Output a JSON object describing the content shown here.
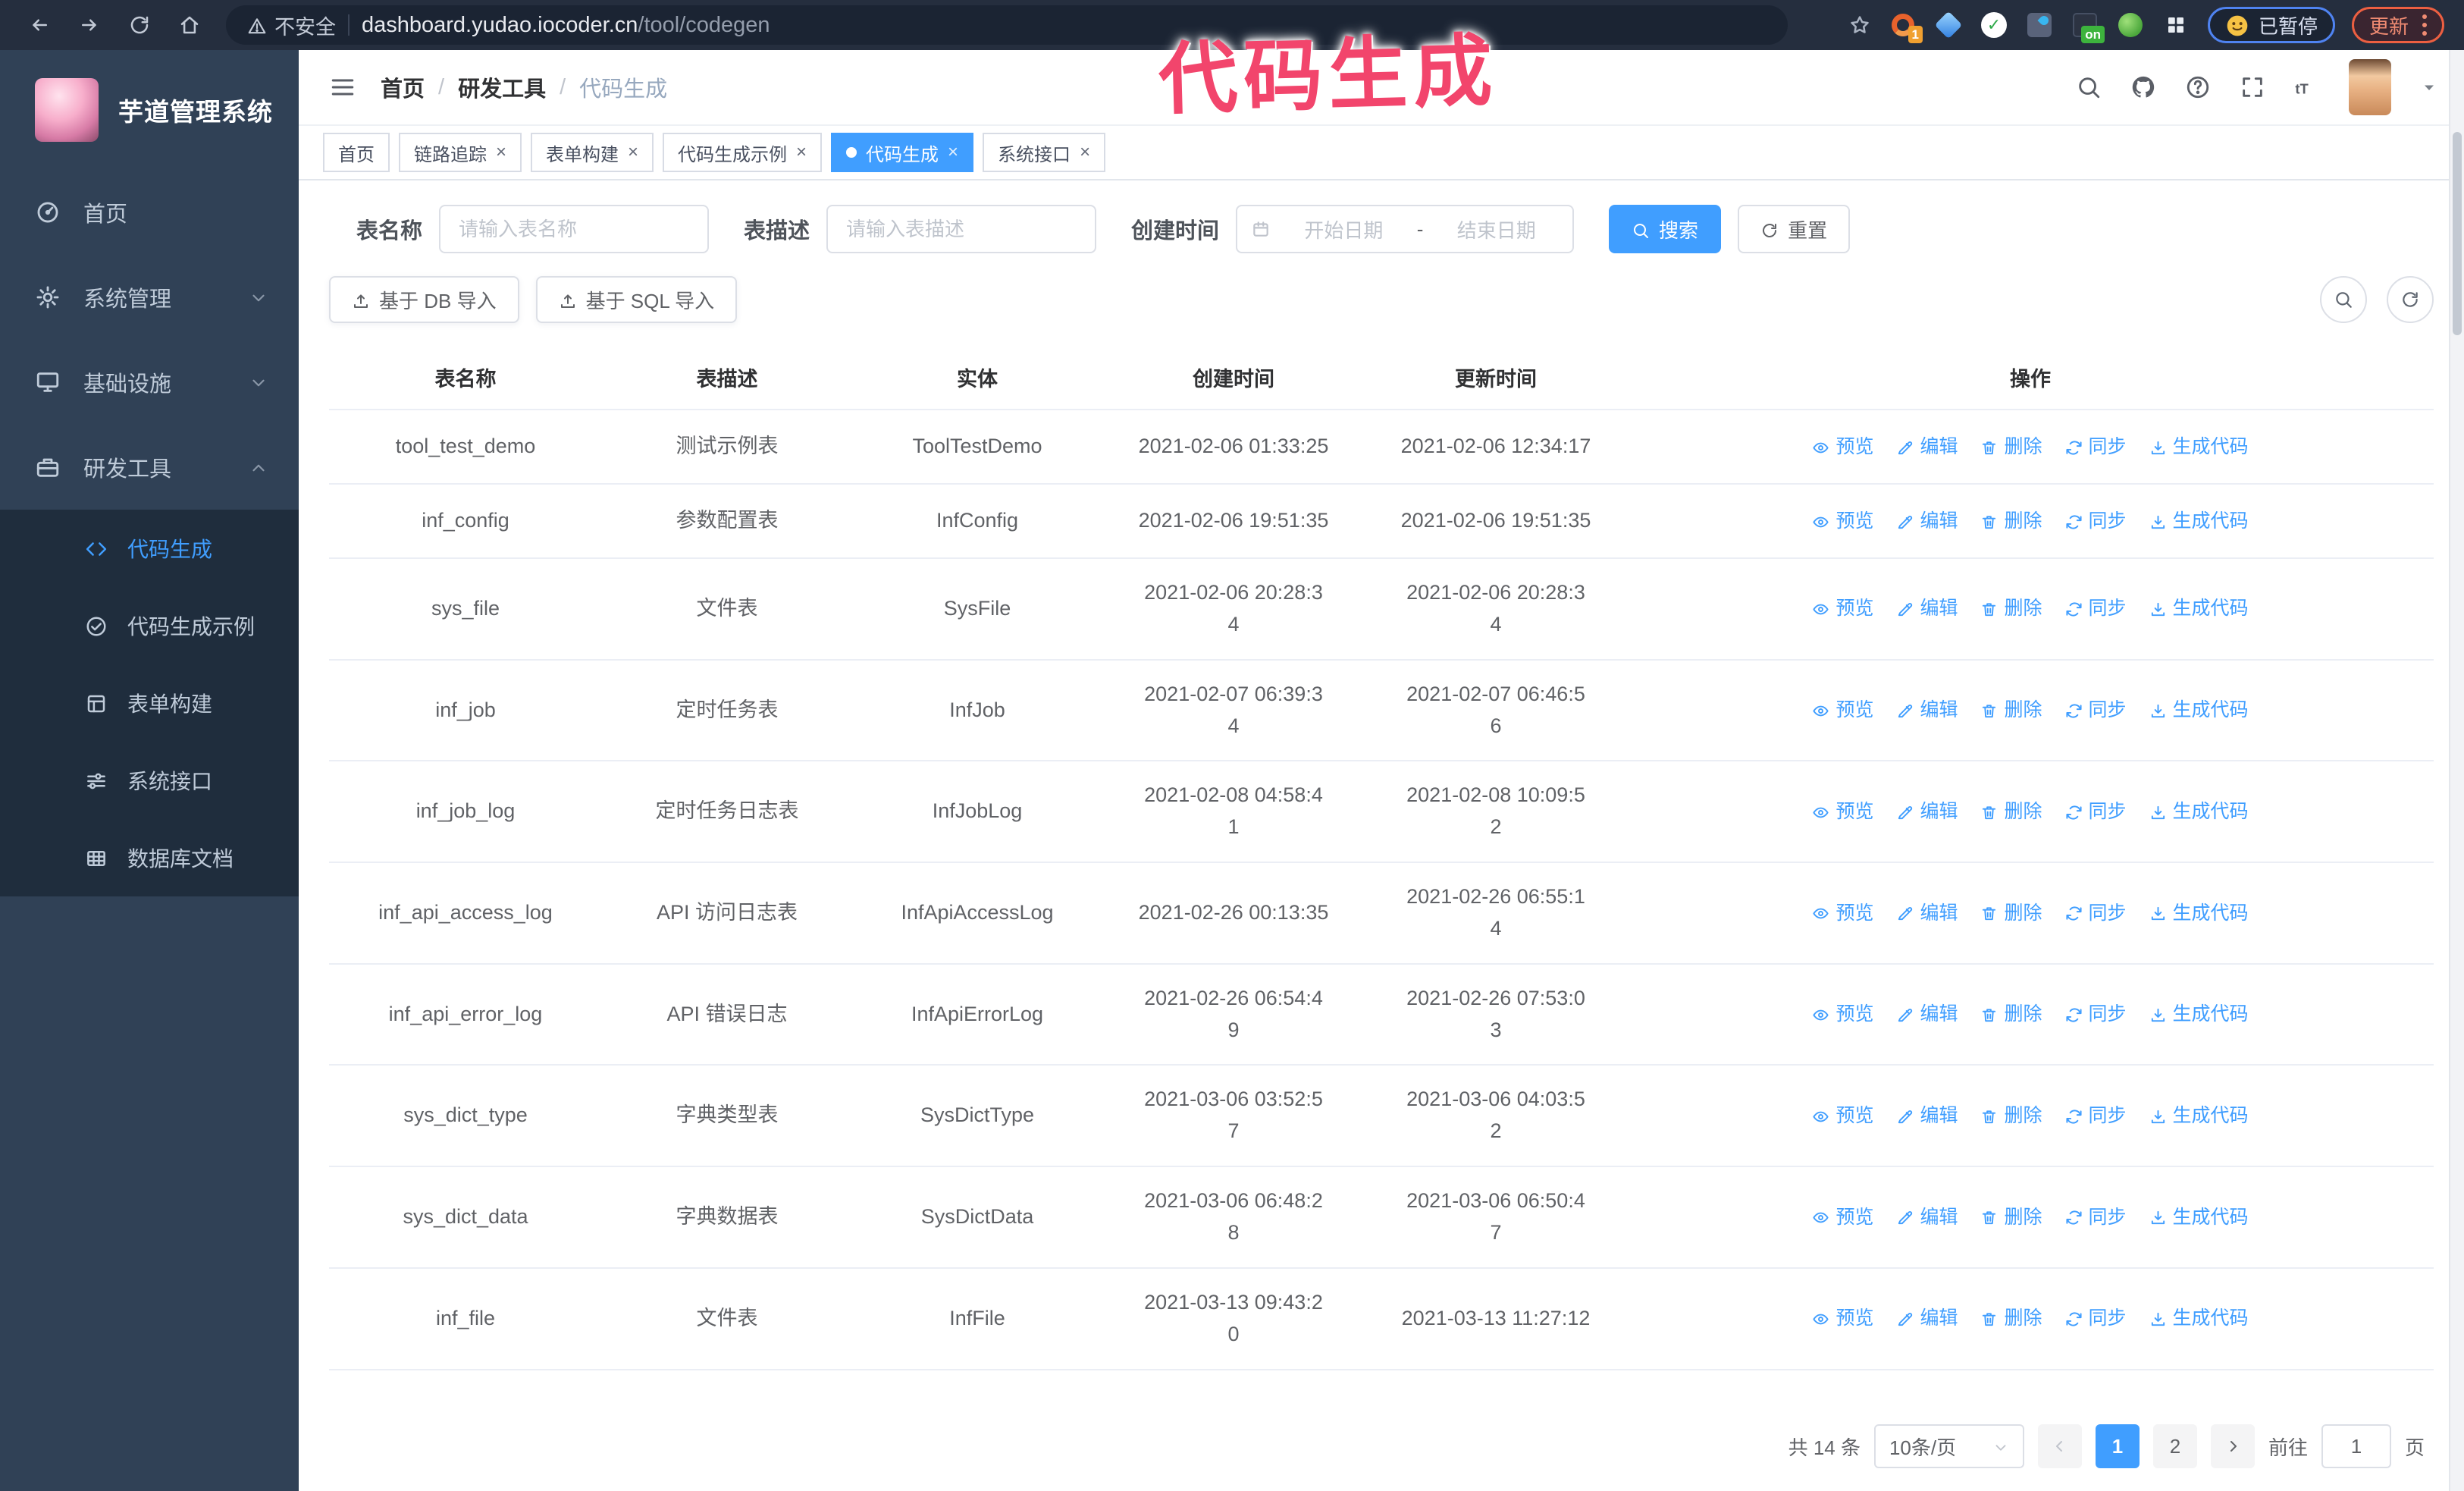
{
  "theme": {
    "primary": "#409EFF",
    "sidebar_bg": "#304156",
    "submenu_bg": "#1f2d3d",
    "sidebar_text": "#bfcbd9",
    "watermark_pink": "#f2456c",
    "tag_border": "#d8dce5",
    "table_border": "#ebeef5"
  },
  "watermark": "代码生成",
  "browser": {
    "nav_icons": [
      {
        "icon": "back-icon"
      },
      {
        "icon": "forward-icon"
      },
      {
        "icon": "reload-icon"
      },
      {
        "icon": "home-icon"
      }
    ],
    "security_label": "不安全",
    "url_host": "dashboard.yudao.iocoder.cn",
    "url_path": "/tool/codegen",
    "extensions": [
      {
        "icon": "ring-orange-icon",
        "badge": "1",
        "badge_color": "#f0a030"
      },
      {
        "icon": "gem-blue-icon"
      },
      {
        "icon": "check-green-icon"
      },
      {
        "icon": "drop-blue-icon"
      },
      {
        "icon": "dark-on-icon",
        "badge": "on",
        "badge_color": "#3db33d"
      },
      {
        "icon": "frog-green-icon"
      },
      {
        "icon": "puzzle-icon"
      }
    ],
    "paused_chip": {
      "icon": "emoji-face-icon",
      "label": "已暂停"
    },
    "update_chip": {
      "label": "更新"
    }
  },
  "sidebar": {
    "logo_title": "芋道管理系统",
    "menu": [
      {
        "label": "首页",
        "icon": "dashboard-icon"
      },
      {
        "label": "系统管理",
        "icon": "gear-icon",
        "chevron": "down"
      },
      {
        "label": "基础设施",
        "icon": "monitor-icon",
        "chevron": "down"
      },
      {
        "label": "研发工具",
        "icon": "toolbox-icon",
        "chevron": "up",
        "expanded": true,
        "children": [
          {
            "label": "代码生成",
            "icon": "code-icon",
            "active": true
          },
          {
            "label": "代码生成示例",
            "icon": "example-icon"
          },
          {
            "label": "表单构建",
            "icon": "form-icon"
          },
          {
            "label": "系统接口",
            "icon": "api-icon"
          },
          {
            "label": "数据库文档",
            "icon": "database-icon"
          }
        ]
      }
    ]
  },
  "navbar": {
    "breadcrumb": [
      "首页",
      "研发工具",
      "代码生成"
    ],
    "separator": "/",
    "right_icons": [
      {
        "icon": "search-icon"
      },
      {
        "icon": "github-icon"
      },
      {
        "icon": "help-icon"
      },
      {
        "icon": "fullscreen-icon"
      },
      {
        "icon": "font-size-icon"
      }
    ]
  },
  "tabs": [
    {
      "label": "首页",
      "closable": false,
      "active": false
    },
    {
      "label": "链路追踪",
      "closable": true,
      "active": false
    },
    {
      "label": "表单构建",
      "closable": true,
      "active": false
    },
    {
      "label": "代码生成示例",
      "closable": true,
      "active": false
    },
    {
      "label": "代码生成",
      "closable": true,
      "active": true
    },
    {
      "label": "系统接口",
      "closable": true,
      "active": false
    }
  ],
  "filters": {
    "table_name_label": "表名称",
    "table_name_placeholder": "请输入表名称",
    "table_desc_label": "表描述",
    "table_desc_placeholder": "请输入表描述",
    "create_time_label": "创建时间",
    "date_start_placeholder": "开始日期",
    "date_separator": "-",
    "date_end_placeholder": "结束日期",
    "search_button": "搜索",
    "reset_button": "重置"
  },
  "toolbar": {
    "import_db": "基于 DB 导入",
    "import_sql": "基于 SQL 导入"
  },
  "table": {
    "columns": [
      "表名称",
      "表描述",
      "实体",
      "创建时间",
      "更新时间",
      "操作"
    ],
    "actions": [
      {
        "key": "preview",
        "label": "预览",
        "icon": "eye-icon"
      },
      {
        "key": "edit",
        "label": "编辑",
        "icon": "edit-icon"
      },
      {
        "key": "delete",
        "label": "删除",
        "icon": "trash-icon"
      },
      {
        "key": "sync",
        "label": "同步",
        "icon": "sync-icon"
      },
      {
        "key": "generate",
        "label": "生成代码",
        "icon": "download-icon"
      }
    ],
    "rows": [
      {
        "name": "tool_test_demo",
        "desc": "测试示例表",
        "entity": "ToolTestDemo",
        "created": "2021-02-06 01:33:25",
        "updated": "2021-02-06 12:34:17"
      },
      {
        "name": "inf_config",
        "desc": "参数配置表",
        "entity": "InfConfig",
        "created": "2021-02-06 19:51:35",
        "updated": "2021-02-06 19:51:35"
      },
      {
        "name": "sys_file",
        "desc": "文件表",
        "entity": "SysFile",
        "created": "2021-02-06 20:28:3\n4",
        "updated": "2021-02-06 20:28:3\n4"
      },
      {
        "name": "inf_job",
        "desc": "定时任务表",
        "entity": "InfJob",
        "created": "2021-02-07 06:39:3\n4",
        "updated": "2021-02-07 06:46:5\n6"
      },
      {
        "name": "inf_job_log",
        "desc": "定时任务日志表",
        "entity": "InfJobLog",
        "created": "2021-02-08 04:58:4\n1",
        "updated": "2021-02-08 10:09:5\n2"
      },
      {
        "name": "inf_api_access_log",
        "desc": "API 访问日志表",
        "entity": "InfApiAccessLog",
        "created": "2021-02-26 00:13:35",
        "updated": "2021-02-26 06:55:1\n4"
      },
      {
        "name": "inf_api_error_log",
        "desc": "API 错误日志",
        "entity": "InfApiErrorLog",
        "created": "2021-02-26 06:54:4\n9",
        "updated": "2021-02-26 07:53:0\n3"
      },
      {
        "name": "sys_dict_type",
        "desc": "字典类型表",
        "entity": "SysDictType",
        "created": "2021-03-06 03:52:5\n7",
        "updated": "2021-03-06 04:03:5\n2"
      },
      {
        "name": "sys_dict_data",
        "desc": "字典数据表",
        "entity": "SysDictData",
        "created": "2021-03-06 06:48:2\n8",
        "updated": "2021-03-06 06:50:4\n7"
      },
      {
        "name": "inf_file",
        "desc": "文件表",
        "entity": "InfFile",
        "created": "2021-03-13 09:43:2\n0",
        "updated": "2021-03-13 11:27:12"
      }
    ]
  },
  "pagination": {
    "total": "共 14 条",
    "page_size": "10条/页",
    "pages": [
      "1",
      "2"
    ],
    "current": "1",
    "goto_label": "前往",
    "goto_value": "1",
    "goto_unit": "页"
  }
}
